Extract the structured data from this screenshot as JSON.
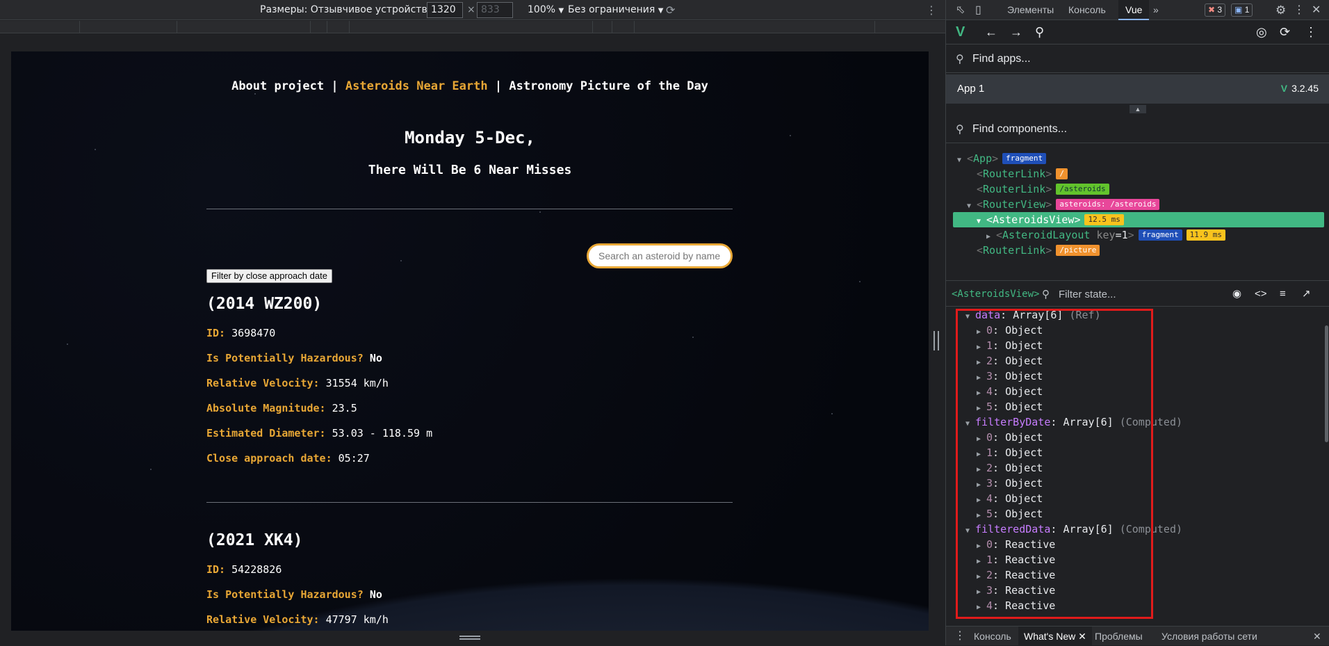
{
  "device_toolbar": {
    "dimensions_label": "Размеры: Отзывчивое устройство",
    "width_value": "1320",
    "height_value": "833",
    "zoom": "100%",
    "throttle": "Без ограничения"
  },
  "site": {
    "nav": [
      {
        "label": "About project",
        "active": false
      },
      {
        "label": "Asteroids Near Earth",
        "active": true
      },
      {
        "label": "Astronomy Picture of the Day",
        "active": false
      }
    ],
    "nav_separator": "|",
    "date_title": "Monday 5-Dec,",
    "misses_title": "There Will Be 6 Near Misses",
    "search_placeholder": "Search an asteroid by name",
    "filter_button": "Filter by close approach date",
    "labels": {
      "id": "ID:",
      "hazardous": "Is Potentially Hazardous?",
      "velocity": "Relative Velocity:",
      "magnitude": "Absolute Magnitude:",
      "diameter": "Estimated Diameter:",
      "approach": "Close approach date:"
    },
    "asteroids": [
      {
        "name": "(2014 WZ200)",
        "id": "3698470",
        "hazardous": "No",
        "velocity": "31554 km/h",
        "magnitude": "23.5",
        "diameter": "53.03 - 118.59 m",
        "approach": "05:27"
      },
      {
        "name": "(2021 XK4)",
        "id": "54228826",
        "hazardous": "No",
        "velocity": "47797 km/h"
      }
    ]
  },
  "devtools": {
    "tabs": [
      "Элементы",
      "Консоль",
      "Vue"
    ],
    "more_tabs": "»",
    "errors": "3",
    "messages": "1",
    "find_apps": "Find apps...",
    "app_name": "App 1",
    "vue_version": "3.2.45",
    "find_components": "Find components...",
    "tree": {
      "app": "App",
      "app_badge": "fragment",
      "router_link": "RouterLink",
      "router_view": "RouterView",
      "link1_badge": "/",
      "link2_badge": "/asteroids",
      "view_badge": "asteroids: /asteroids",
      "asteroids_view": "AsteroidsView",
      "asteroids_view_time": "12.5 ms",
      "asteroid_layout": "AsteroidLayout",
      "layout_key": "key",
      "layout_key_value": "=1",
      "layout_badge": "fragment",
      "layout_time": "11.9 ms",
      "link3_badge": "/picture"
    },
    "selected_component": "<AsteroidsView>",
    "filter_state": "Filter state...",
    "state": {
      "data_key": "data",
      "data_type": "Array[6]",
      "data_meta": "(Ref)",
      "filter_key": "filterByDate",
      "filter_type": "Array[6]",
      "filter_meta": "(Computed)",
      "filtered_key": "filteredData",
      "filtered_type": "Array[6]",
      "filtered_meta": "(Computed)",
      "object_label": "Object",
      "reactive_label": "Reactive"
    },
    "drawer_tabs": [
      "Консоль",
      "What's New",
      "Проблемы",
      "Условия работы сети"
    ]
  }
}
